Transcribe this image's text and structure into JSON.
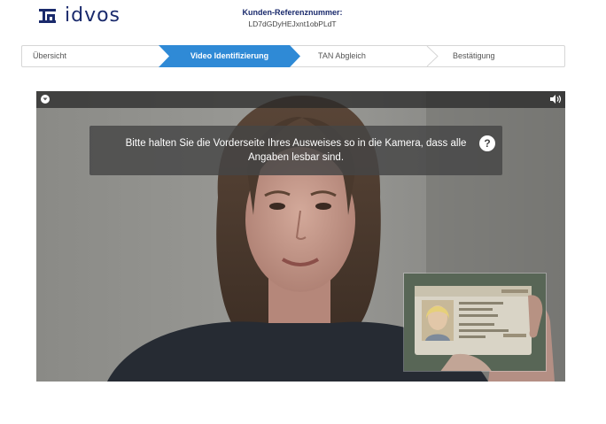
{
  "header": {
    "logo_text": "idvos",
    "reference_label": "Kunden-Referenznummer:",
    "reference_value": "LD7dGDyHEJxnt1obPLdT"
  },
  "stepper": {
    "steps": [
      {
        "label": "Übersicht",
        "active": false
      },
      {
        "label": "Video Identifizierung",
        "active": true
      },
      {
        "label": "TAN Abgleich",
        "active": false
      },
      {
        "label": "Bestätigung",
        "active": false
      }
    ],
    "active_color": "#2f8ad6"
  },
  "video": {
    "instruction": "Bitte halten Sie die Vorderseite Ihres Ausweises so in die Kamera, dass alle Angaben lesbar sind.",
    "help_symbol": "?",
    "icons": {
      "top_left": "shield-icon",
      "top_right": "speaker-icon",
      "help": "help-icon"
    }
  },
  "colors": {
    "brand": "#1a2a6c",
    "accent": "#2f8ad6"
  }
}
